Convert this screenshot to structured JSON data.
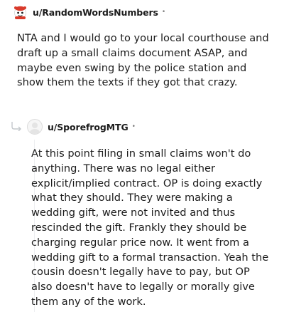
{
  "comments": [
    {
      "username": "u/RandomWordsNumbers",
      "separator": "•",
      "body": "NTA and I would go to your local courthouse and draft up a small claims document ASAP, and maybe even swing by the police station and show them the texts if they got that crazy.",
      "avatar_icon": "snoo-avatar-icon"
    },
    {
      "username": "u/SporefrogMTG",
      "separator": "•",
      "body": "At this point filing in small claims won't do anything. There was no legal either explicit/implied contract. OP is doing exactly what they should. They were making a wedding gift, were not invited and thus rescinded the gift. Frankly they should be charging regular price now. It went from a wedding gift to a formal transaction. Yeah the cousin doesn't legally have to pay, but OP also doesn't have to legally or morally give them any of the work.",
      "avatar_icon": "default-avatar-icon",
      "reply_icon": "reply-arrow-icon"
    }
  ],
  "colors": {
    "text": "#1c1c1c",
    "meta": "#7c7c7c",
    "thread_line": "#edeff1",
    "avatar_red": "#d93a2b"
  }
}
